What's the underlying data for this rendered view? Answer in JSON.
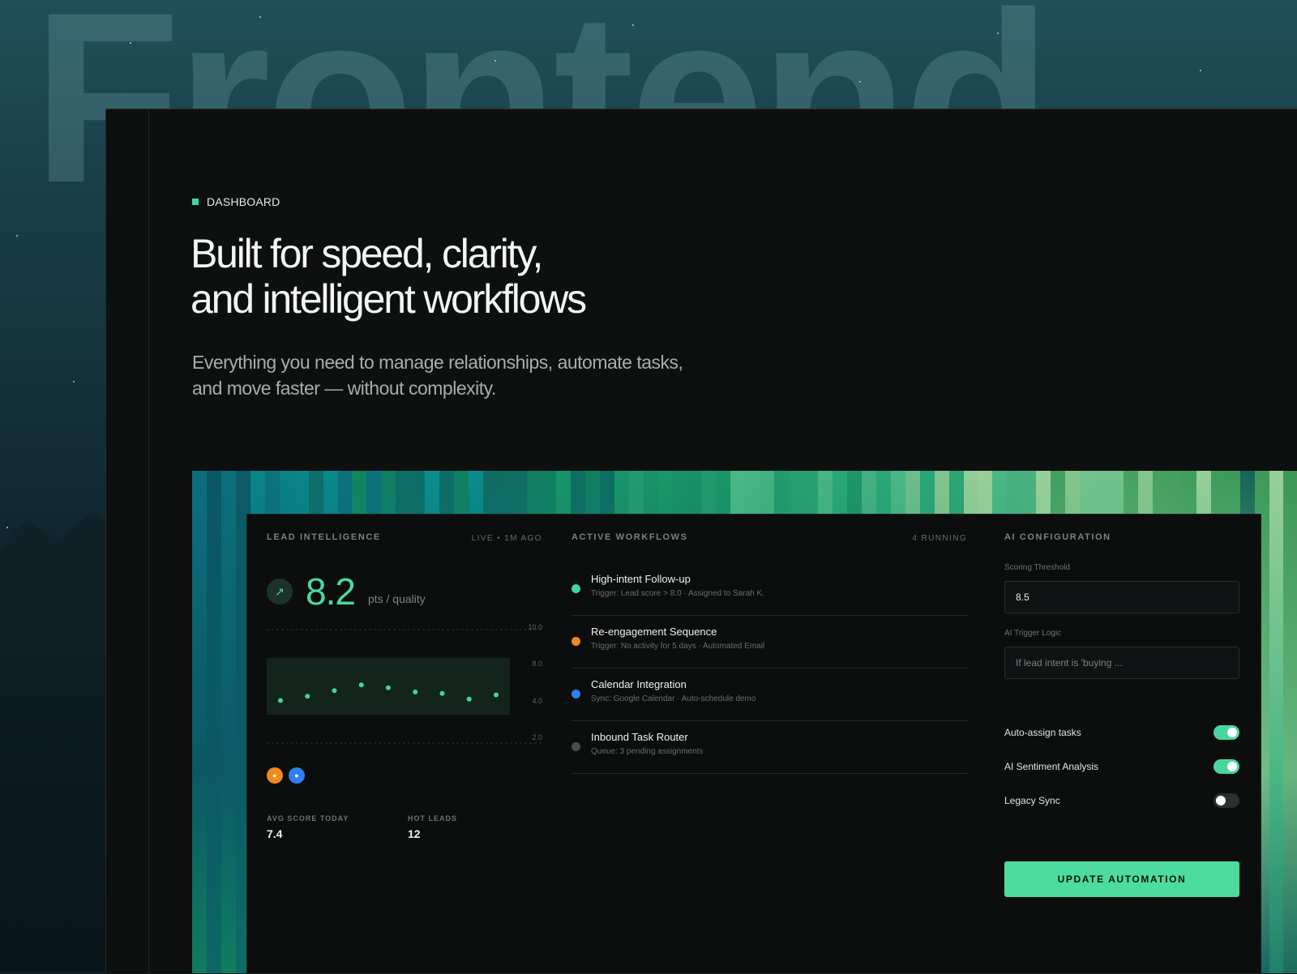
{
  "background": {
    "word": "Frontend"
  },
  "hero": {
    "eyebrow": "DASHBOARD",
    "headline_line1": "Built for speed, clarity,",
    "headline_line2": "and intelligent workflows",
    "sub_line1": "Everything you need to manage relationships, automate tasks,",
    "sub_line2": "and move faster — without complexity."
  },
  "lead_intelligence": {
    "title": "LEAD INTELLIGENCE",
    "status": "LIVE • 1M AGO",
    "score": "8.2",
    "unit": "pts / quality",
    "trend_icon": "arrow-up-right-icon",
    "ticks": [
      "10.0",
      "8.0",
      "4.0",
      "2.0"
    ],
    "avatar_colors": [
      "#f08a1c",
      "#2f7ff0"
    ],
    "stats": [
      {
        "label": "AVG SCORE TODAY",
        "value": "7.4"
      },
      {
        "label": "HOT LEADS",
        "value": "12"
      }
    ]
  },
  "chart_data": {
    "type": "scatter",
    "title": "",
    "xlabel": "",
    "ylabel": "",
    "x": [
      1,
      2,
      3,
      4,
      5,
      6,
      7,
      8,
      9
    ],
    "values": [
      5.0,
      5.3,
      5.7,
      6.1,
      5.9,
      5.6,
      5.5,
      5.1,
      5.4
    ],
    "yticks": [
      "10.0",
      "8.0",
      "4.0",
      "2.0"
    ],
    "ylim": [
      2,
      10
    ],
    "grid": true,
    "color": "#3fd89a"
  },
  "workflows": {
    "title": "ACTIVE WORKFLOWS",
    "status": "4 RUNNING",
    "items": [
      {
        "name": "High-intent Follow-up",
        "desc": "Trigger: Lead score > 8.0 · Assigned to Sarah K.",
        "color": "#3fd89a"
      },
      {
        "name": "Re-engagement Sequence",
        "desc": "Trigger: No activity for 5 days · Automated Email",
        "color": "#f08a1c"
      },
      {
        "name": "Calendar Integration",
        "desc": "Sync: Google Calendar · Auto-schedule demo",
        "color": "#2f7ff0"
      },
      {
        "name": "Inbound Task Router",
        "desc": "Queue: 3 pending assignments",
        "color": "#4a4f4e"
      }
    ]
  },
  "ai_config": {
    "title": "AI CONFIGURATION",
    "threshold_label": "Scoring Threshold",
    "threshold_value": "8.5",
    "logic_label": "AI Trigger Logic",
    "logic_placeholder": "If lead intent is 'buying ...",
    "toggles": [
      {
        "label": "Auto-assign tasks",
        "on": true
      },
      {
        "label": "AI Sentiment Analysis",
        "on": true
      },
      {
        "label": "Legacy Sync",
        "on": false
      }
    ],
    "button": "UPDATE AUTOMATION"
  }
}
